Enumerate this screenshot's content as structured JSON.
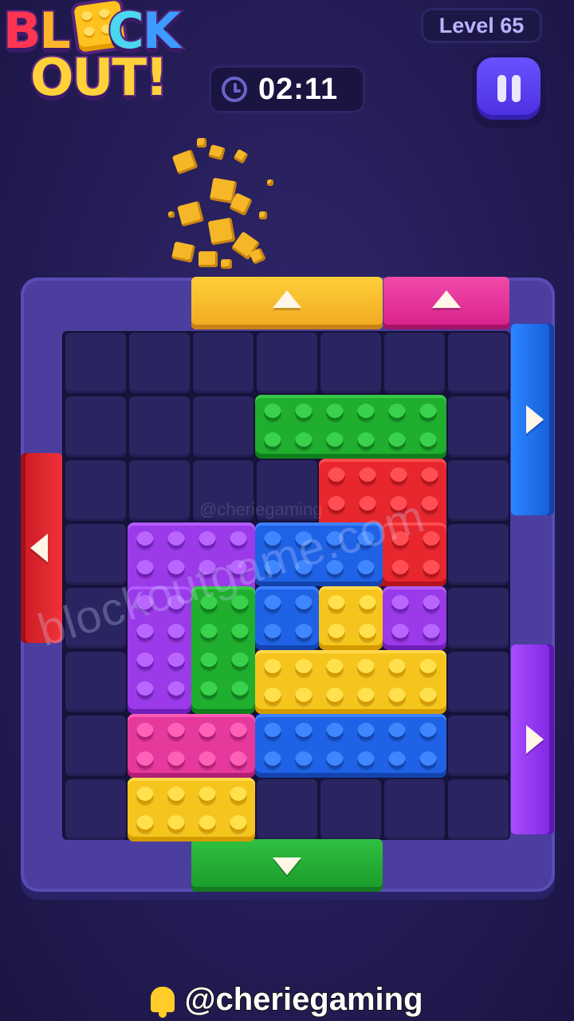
{
  "header": {
    "logo_line1": [
      "B",
      "L",
      "O",
      "C",
      "K"
    ],
    "logo_line2": "OUT!",
    "level_label": "Level 65",
    "timer": "02:11"
  },
  "board": {
    "rows": 8,
    "cols": 7,
    "gates": [
      {
        "side": "top",
        "color": "#f0b12a",
        "dir": "up"
      },
      {
        "side": "top",
        "color": "#e3289a",
        "dir": "up"
      },
      {
        "side": "right",
        "color": "#1e74ea",
        "dir": "right"
      },
      {
        "side": "right",
        "color": "#9a2ff0",
        "dir": "right"
      },
      {
        "side": "left",
        "color": "#e62630",
        "dir": "left"
      },
      {
        "side": "bottom",
        "color": "#23a935",
        "dir": "down"
      }
    ],
    "blocks": [
      {
        "color": "green",
        "desc": "1x3 bar"
      },
      {
        "color": "red",
        "desc": "L piece"
      },
      {
        "color": "purple",
        "desc": "U piece"
      },
      {
        "color": "blue",
        "desc": "L piece"
      },
      {
        "color": "green",
        "desc": "vertical 1x2"
      },
      {
        "color": "yellow",
        "desc": "T piece"
      },
      {
        "color": "pink",
        "desc": "1x2 bar"
      },
      {
        "color": "blue",
        "desc": "1x3 bar"
      },
      {
        "color": "yellow",
        "desc": "1x2 bar"
      }
    ]
  },
  "watermark": "blockoutgame.com",
  "watermark_small": "@cheriegaming",
  "footer_handle": "@cheriegaming",
  "colors": {
    "bg": "#251d57",
    "frame": "#4b3e9e",
    "green": "#1fae2e",
    "red": "#e8262e",
    "purple": "#9a3ae8",
    "blue": "#1f62e6",
    "yellow": "#f5c51e",
    "pink": "#e5399c"
  }
}
